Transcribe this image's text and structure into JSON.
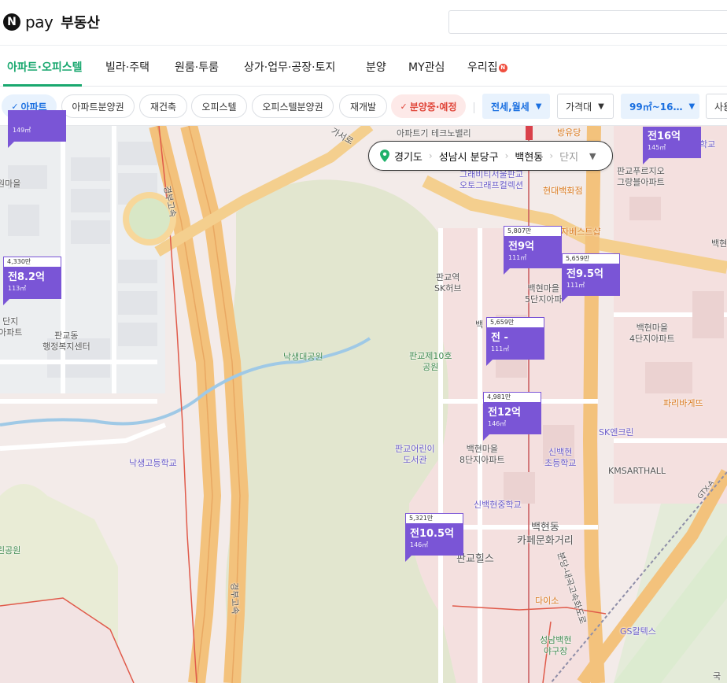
{
  "logo": {
    "n": "N",
    "pay": "pay",
    "service": "부동산"
  },
  "nav": {
    "items": [
      "아파트·오피스텔",
      "빌라·주택",
      "원룸·투룸",
      "상가·업무·공장·토지",
      "분양",
      "MY관심",
      "우리집"
    ],
    "new_badge": "N"
  },
  "filters": {
    "chips": [
      "아파트",
      "아파트분양권",
      "재건축",
      "오피스텔",
      "오피스텔분양권",
      "재개발",
      "분양중·예정"
    ],
    "check": "✓",
    "dropdowns": [
      "전세,월세",
      "가격대",
      "99㎡~16…",
      "사용"
    ]
  },
  "location": {
    "province": "경기도",
    "district": "성남시 분당구",
    "dong": "백현동",
    "complex": "단지"
  },
  "map_labels": {
    "top_clipped": "아파트기 테크노밸리",
    "rural_village": "원마을",
    "pangyo_welfare": "판교동\n행정복지센터",
    "apt_left": "단지\n아파트",
    "nakseong_park": "낙생대공원",
    "pangyo10_park": "판교제10호\n공원",
    "pangyo_station": "판교역\nSK허브",
    "baekhyun5": "백현마을\n5단지아파",
    "baekhyun4": "백현마을\n4단지아파트",
    "graphite": "그래비티서울판교\n오토그래프컬렉션",
    "hyundai": "현대백화점",
    "pangyo_futurezio": "판교푸르지오\n그랑블아파트",
    "bangyudang": "방유당",
    "jasan_best": "자베스트샵",
    "pangyo_child_library": "판교어린이\n도서관",
    "baekhyun8": "백현마을\n8단지아파트",
    "sinbaekhyun_elem": "신백현\n초등학교",
    "sk_enclean": "SK엔크린",
    "kmsart": "KMSARTHALL",
    "sinbaekhyun_mid": "신백현중학교",
    "nakseong_high": "낙생고등학교",
    "baekhyun_cafe": "백현동\n카페문화거리",
    "pangyo_hills": "판교힐스",
    "daiso": "다이소",
    "seongnam_baseball": "성남백현\n야구장",
    "gs_caltex": "GS칼텍스",
    "paris": "파리바게뜨",
    "bundang_expressway": "분당-내곡고속화도로",
    "gyeongbu": "경부고속",
    "gyeongbu2": "경부고속",
    "park_left": "린공원",
    "hak": "학교",
    "gtx": "GTX-A",
    "gasu": "가서로",
    "baek": "백",
    "baek_right": "백현",
    "gu": "국"
  },
  "markers": [
    {
      "id": "m1",
      "price_head": "",
      "price": "",
      "area": "149㎡"
    },
    {
      "id": "m2",
      "price_head": "4,330만",
      "price": "전8.2억",
      "area": "113㎡"
    },
    {
      "id": "m3",
      "price_head": "",
      "price": "전16억",
      "area": "145㎡"
    },
    {
      "id": "m4",
      "price_head": "5,807만",
      "price": "전9억",
      "area": "111㎡"
    },
    {
      "id": "m5",
      "price_head": "5,659만",
      "price": "전9.5억",
      "area": "111㎡"
    },
    {
      "id": "m6",
      "price_head": "5,659만",
      "price": "전 -",
      "area": "111㎡"
    },
    {
      "id": "m7",
      "price_head": "4,981만",
      "price": "전12억",
      "area": "146㎡"
    },
    {
      "id": "m8",
      "price_head": "5,321만",
      "price": "전10.5억",
      "area": "146㎡"
    }
  ],
  "colors": {
    "accent": "#19a86f",
    "marker": "#7a55d6",
    "filter_blue": "#1a6fe0",
    "filter_red": "#e0463a"
  }
}
